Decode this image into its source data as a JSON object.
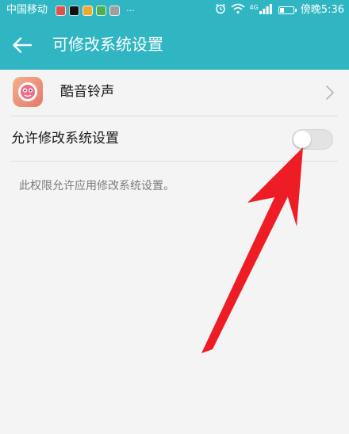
{
  "status_bar": {
    "carrier": "中国移动",
    "notification_icons": [
      {
        "name": "app-notification-icon",
        "color": "#d9534f"
      },
      {
        "name": "tiktok-icon",
        "color": "#111111"
      },
      {
        "name": "video-app-icon",
        "color": "#f0a830"
      },
      {
        "name": "image-app-icon",
        "color": "#4caf50"
      },
      {
        "name": "home-app-icon",
        "color": "#9e9e9e"
      }
    ],
    "more": "···",
    "network_type": "4G",
    "battery_level": 0.3,
    "time": "傍晚5:36"
  },
  "nav": {
    "title": "可修改系统设置"
  },
  "app": {
    "name": "酷音铃声"
  },
  "setting": {
    "label": "允许修改系统设置",
    "enabled": false
  },
  "description": "此权限允许应用修改系统设置。",
  "colors": {
    "header": "#2fb6c2",
    "background": "#f4f4f5",
    "arrow": "#ee1c25"
  }
}
